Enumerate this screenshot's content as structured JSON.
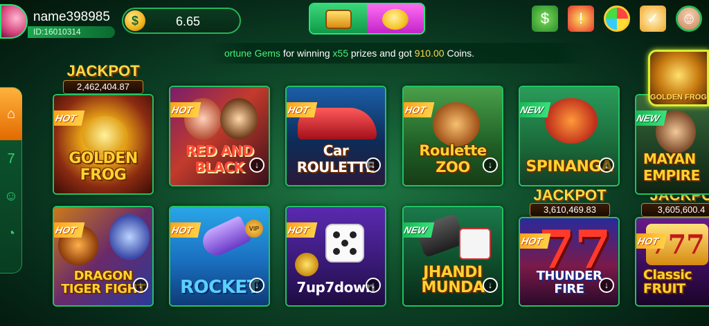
{
  "user": {
    "name": "name398985",
    "id": "ID:16010314"
  },
  "balance": {
    "icon": "dollar-coin-icon",
    "value": "6.65"
  },
  "promo_tabs": [
    {
      "name": "treasure-chest-icon"
    },
    {
      "name": "piggy-bank-icon"
    }
  ],
  "top_icons": [
    {
      "name": "cash-icon",
      "glyph": "$"
    },
    {
      "name": "gift-icon",
      "glyph": "!"
    },
    {
      "name": "prize-wheel-icon",
      "glyph": ""
    },
    {
      "name": "task-icon",
      "glyph": "✓"
    },
    {
      "name": "customer-support-icon",
      "glyph": "☺"
    }
  ],
  "marquee": {
    "game": "ortune Gems",
    "mid": " for winning ",
    "multiplier": "x55",
    "mid2": " prizes and got ",
    "amount": "910.00",
    "tail": " Coins."
  },
  "left_rail": [
    {
      "name": "home-icon",
      "glyph": "⌂"
    },
    {
      "name": "slots-777-icon",
      "glyph": "7"
    },
    {
      "name": "friends-icon",
      "glyph": "☺"
    },
    {
      "name": "clock-icon",
      "glyph": "◔"
    }
  ],
  "jackpots": [
    {
      "label": "JACKPOT",
      "value": "2,462,404.87"
    },
    {
      "label": "JACKPOT",
      "value": "3,610,469.83"
    },
    {
      "label": "JACKPOT",
      "value": "3,605,600.4"
    }
  ],
  "games_row1": [
    {
      "title": "GOLDEN FROG",
      "badge": "HOT",
      "download": false
    },
    {
      "title": "RED AND BLACK",
      "badge": "HOT",
      "download": true
    },
    {
      "title": "Car ROULETTE",
      "badge": "HOT",
      "download": true
    },
    {
      "title": "Roulette ZOO",
      "badge": "HOT",
      "download": true
    },
    {
      "title": "SPINANGA",
      "badge": "NEW",
      "download": true
    },
    {
      "title": "MAYAN EMPIRE",
      "badge": "NEW",
      "download": false
    }
  ],
  "games_row2": [
    {
      "title": "DRAGON TIGER FIGHT",
      "badge": "HOT",
      "download": true
    },
    {
      "title": "ROCKET",
      "badge": "HOT",
      "download": true
    },
    {
      "title": "7up7down",
      "badge": "HOT",
      "download": true
    },
    {
      "title": "JHANDI MUNDA",
      "badge": "NEW",
      "download": true
    },
    {
      "title": "THUNDER FIRE",
      "badge": "HOT",
      "download": true
    },
    {
      "title": "Classic FRUIT",
      "badge": "HOT",
      "download": false
    }
  ],
  "floating_game": {
    "title": "GOLDEN FROG"
  },
  "colors": {
    "accent": "#1fc463",
    "gold": "#ffd230",
    "hot": "#ff9b12",
    "new": "#11b34f"
  }
}
